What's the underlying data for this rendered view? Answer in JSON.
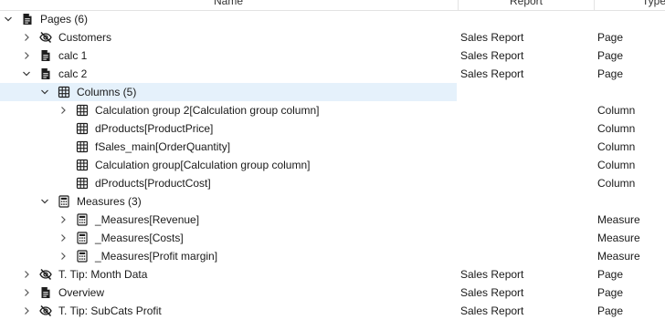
{
  "header": {
    "name": "Name",
    "report": "Report",
    "type": "Type"
  },
  "rows": [
    {
      "label": "Pages (6)",
      "report": "",
      "type": "",
      "level": 0,
      "chev": "down",
      "icon": "page-icon",
      "selected": false
    },
    {
      "label": "Customers",
      "report": "Sales Report",
      "type": "Page",
      "level": 1,
      "chev": "right",
      "icon": "hidden-eye-icon",
      "selected": false
    },
    {
      "label": "calc 1",
      "report": "Sales Report",
      "type": "Page",
      "level": 1,
      "chev": "right",
      "icon": "page-icon",
      "selected": false
    },
    {
      "label": "calc 2",
      "report": "Sales Report",
      "type": "Page",
      "level": 1,
      "chev": "down",
      "icon": "page-icon",
      "selected": false
    },
    {
      "label": "Columns (5)",
      "report": "",
      "type": "",
      "level": 2,
      "chev": "down",
      "icon": "table-icon",
      "selected": true
    },
    {
      "label": "Calculation group 2[Calculation group column]",
      "report": "",
      "type": "Column",
      "level": 3,
      "chev": "right",
      "icon": "table-icon",
      "selected": false
    },
    {
      "label": "dProducts[ProductPrice]",
      "report": "",
      "type": "Column",
      "level": 3,
      "chev": "",
      "icon": "table-icon",
      "selected": false
    },
    {
      "label": "fSales_main[OrderQuantity]",
      "report": "",
      "type": "Column",
      "level": 3,
      "chev": "",
      "icon": "table-icon",
      "selected": false
    },
    {
      "label": "Calculation group[Calculation group column]",
      "report": "",
      "type": "Column",
      "level": 3,
      "chev": "",
      "icon": "table-icon",
      "selected": false
    },
    {
      "label": "dProducts[ProductCost]",
      "report": "",
      "type": "Column",
      "level": 3,
      "chev": "",
      "icon": "table-icon",
      "selected": false
    },
    {
      "label": "Measures (3)",
      "report": "",
      "type": "",
      "level": 2,
      "chev": "down",
      "icon": "calculator-icon",
      "selected": false
    },
    {
      "label": "_Measures[Revenue]",
      "report": "",
      "type": "Measure",
      "level": 3,
      "chev": "right",
      "icon": "calculator-icon",
      "selected": false
    },
    {
      "label": "_Measures[Costs]",
      "report": "",
      "type": "Measure",
      "level": 3,
      "chev": "right",
      "icon": "calculator-icon",
      "selected": false
    },
    {
      "label": "_Measures[Profit margin]",
      "report": "",
      "type": "Measure",
      "level": 3,
      "chev": "right",
      "icon": "calculator-icon",
      "selected": false
    },
    {
      "label": "T. Tip: Month Data",
      "report": "Sales Report",
      "type": "Page",
      "level": 1,
      "chev": "right",
      "icon": "hidden-eye-icon",
      "selected": false
    },
    {
      "label": "Overview",
      "report": "Sales Report",
      "type": "Page",
      "level": 1,
      "chev": "right",
      "icon": "page-icon",
      "selected": false
    },
    {
      "label": "T. Tip: SubCats Profit",
      "report": "Sales Report",
      "type": "Page",
      "level": 1,
      "chev": "right",
      "icon": "hidden-eye-icon",
      "selected": false
    }
  ],
  "colors": {
    "selected_row": "#e5f1fb",
    "text": "#1a1a1a",
    "icon": "#222222"
  }
}
